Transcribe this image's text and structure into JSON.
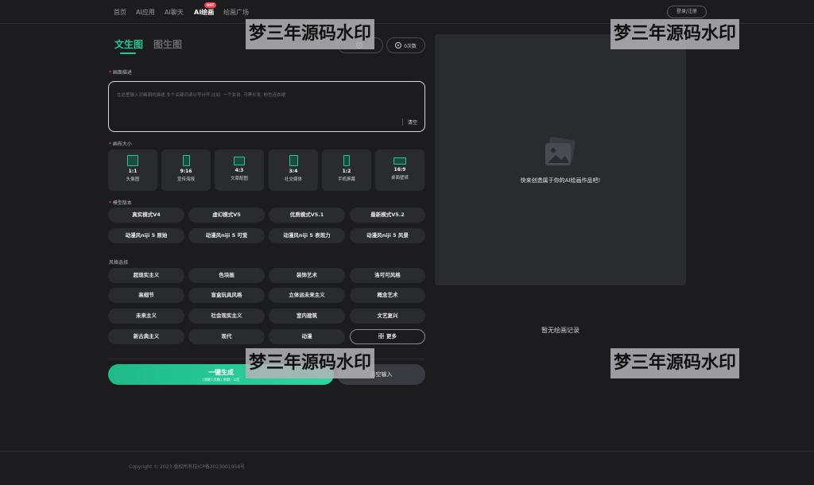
{
  "nav": {
    "items": [
      {
        "label": "首页",
        "active": false
      },
      {
        "label": "AI应用",
        "active": false
      },
      {
        "label": "AI聊天",
        "active": false
      },
      {
        "label": "AI绘画",
        "active": true
      },
      {
        "label": "绘画广场",
        "active": false
      }
    ],
    "hot_badge": "HOT",
    "login_label": "登录/注册"
  },
  "tabs": {
    "active": "文生图",
    "inactive": "图生图"
  },
  "top_pills": {
    "history_label": "",
    "count_label": "0次数"
  },
  "prompt": {
    "label": "画面描述",
    "placeholder": "在这里输入对画面的描述,多个关键词请以号分开,比如: 一个女孩, 乌黑长发, 粉色连衣裙",
    "clear_label": "清空"
  },
  "canvas": {
    "label": "画布大小",
    "ratios": [
      {
        "ratio": "1:1",
        "name": "头像图"
      },
      {
        "ratio": "9:16",
        "name": "宣传海报"
      },
      {
        "ratio": "4:3",
        "name": "文章配图"
      },
      {
        "ratio": "3:4",
        "name": "社交媒体"
      },
      {
        "ratio": "1:2",
        "name": "手机屏幕"
      },
      {
        "ratio": "16:9",
        "name": "桌面壁纸"
      }
    ]
  },
  "model": {
    "label": "模型版本",
    "options": [
      "真实模式V4",
      "虚幻模式V5",
      "优质模式V5.1",
      "最新模式V5.2",
      "动漫风niji 5 原始",
      "动漫风niji 5 可爱",
      "动漫风niji 5 表现力",
      "动漫风niji 5 风景"
    ]
  },
  "style": {
    "label": "风格选择",
    "options": [
      "超现实主义",
      "色块画",
      "装饰艺术",
      "洛可可风格",
      "高细节",
      "盲盒玩具风格",
      "立体派未来主义",
      "概念艺术",
      "未来主义",
      "社会现实主义",
      "室内建筑",
      "文艺复兴",
      "新古典主义",
      "现代",
      "动漫"
    ],
    "more_label": "更多"
  },
  "actions": {
    "generate_label": "一键生成",
    "generate_sub": "(消耗1次数) 余额：0次",
    "clear_input_label": "清空输入"
  },
  "preview": {
    "empty_text": "快来创造属于你的AI绘画作品吧!",
    "no_record": "暂无绘画记录"
  },
  "watermark": "梦三年源码水印",
  "footer": "Copyright © 2023 版权所有桂ICP备2023001958号",
  "colors": {
    "accent": "#20c997",
    "background": "#1c1c1e",
    "card": "#2a2b2f",
    "hot": "#ff3b4e"
  }
}
